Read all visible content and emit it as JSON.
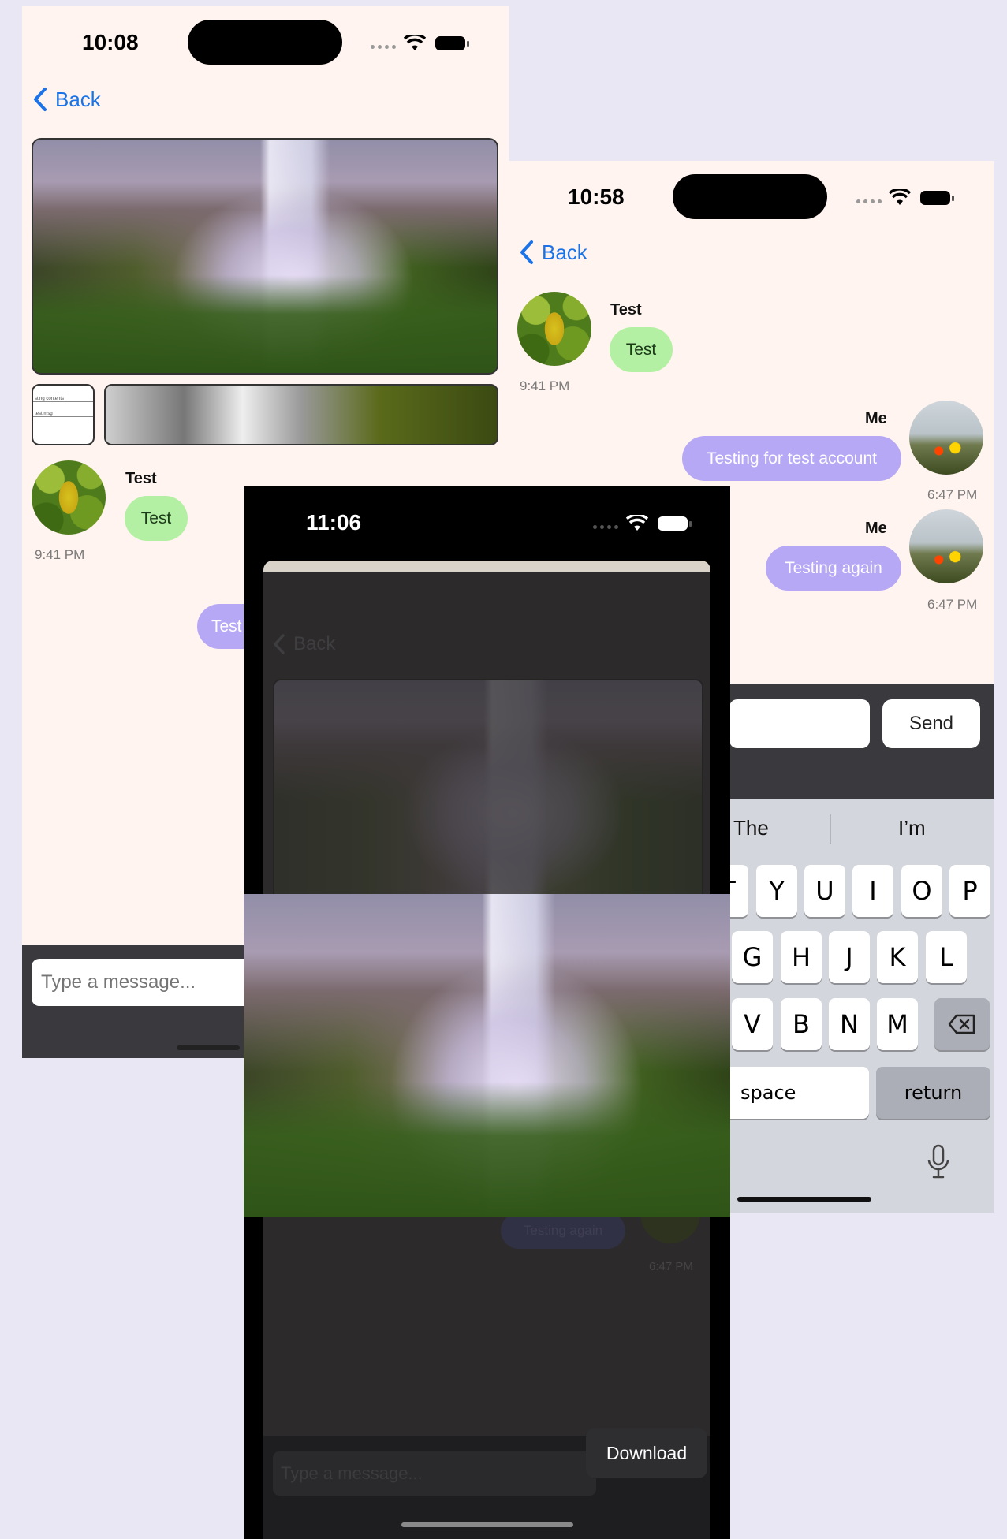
{
  "screen1": {
    "time": "10:08",
    "back_label": "Back",
    "thumb_text_1": "sting contents",
    "thumb_text_2": "test msg",
    "message": {
      "sender": "Test",
      "text": "Test",
      "time": "9:41 PM"
    },
    "out_bubble_partial": "Test",
    "input_placeholder": "Type a message..."
  },
  "screen2": {
    "time": "10:58",
    "back_label": "Back",
    "messages": [
      {
        "sender": "Test",
        "text": "Test",
        "time": "9:41 PM"
      },
      {
        "sender": "Me",
        "text": "Testing for test account",
        "time": "6:47 PM"
      },
      {
        "sender": "Me",
        "text": "Testing again",
        "time": "6:47 PM"
      }
    ],
    "send_label": "Send",
    "keyboard": {
      "suggestions": [
        "The",
        "I’m"
      ],
      "row1": [
        "T",
        "Y",
        "U",
        "I",
        "O",
        "P"
      ],
      "row2": [
        "G",
        "H",
        "J",
        "K",
        "L"
      ],
      "row3": [
        "V",
        "B",
        "N",
        "M"
      ],
      "space_label": "space",
      "return_label": "return"
    }
  },
  "screen3": {
    "time": "11:06",
    "back_label": "Back",
    "dim_bubble": "Testing again",
    "dim_time": "6:47 PM",
    "input_placeholder": "Type a message...",
    "download_label": "Download"
  },
  "colors": {
    "page_bg": "#e9e7f4",
    "chat_bg": "#fff4ef",
    "accent_blue": "#1a73e8",
    "bubble_in": "#b3f0a3",
    "bubble_out": "#b6a8f5"
  }
}
